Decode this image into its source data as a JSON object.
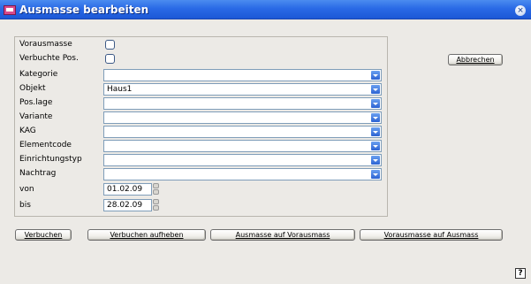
{
  "window": {
    "title": "Ausmasse bearbeiten"
  },
  "form": {
    "vorausmasse_label": "Vorausmasse",
    "verbuchte_label": "Verbuchte Pos.",
    "kategorie_label": "Kategorie",
    "kategorie_value": "",
    "objekt_label": "Objekt",
    "objekt_value": "Haus1",
    "poslage_label": "Pos.lage",
    "poslage_value": "",
    "variante_label": "Variante",
    "variante_value": "",
    "kag_label": "KAG",
    "kag_value": "",
    "elementcode_label": "Elementcode",
    "elementcode_value": "",
    "einrichtungstyp_label": "Einrichtungstyp",
    "einrichtungstyp_value": "",
    "nachtrag_label": "Nachtrag",
    "nachtrag_value": "",
    "von_label": "von",
    "von_value": "01.02.09",
    "bis_label": "bis",
    "bis_value": "28.02.09",
    "vorausmasse_checked": false,
    "verbuchte_checked": false
  },
  "buttons": {
    "abbrechen": "Abbrechen",
    "verbuchen": "Verbuchen",
    "verbuchen_aufheben": "Verbuchen aufheben",
    "ausmasse_auf_vorausmass": "Ausmasse auf Vorausmass",
    "vorausmasse_auf_ausmass": "Vorausmasse auf Ausmass",
    "help": "?"
  },
  "colors": {
    "titlebar": "#2a6ae6",
    "dropdown_button": "#2c63d2",
    "window_bg": "#eceae6"
  },
  "icons": {
    "app": "app-icon",
    "close": "close-icon",
    "dropdown": "chevron-down-icon",
    "spinner": "spinner-icon",
    "help": "help-icon"
  }
}
